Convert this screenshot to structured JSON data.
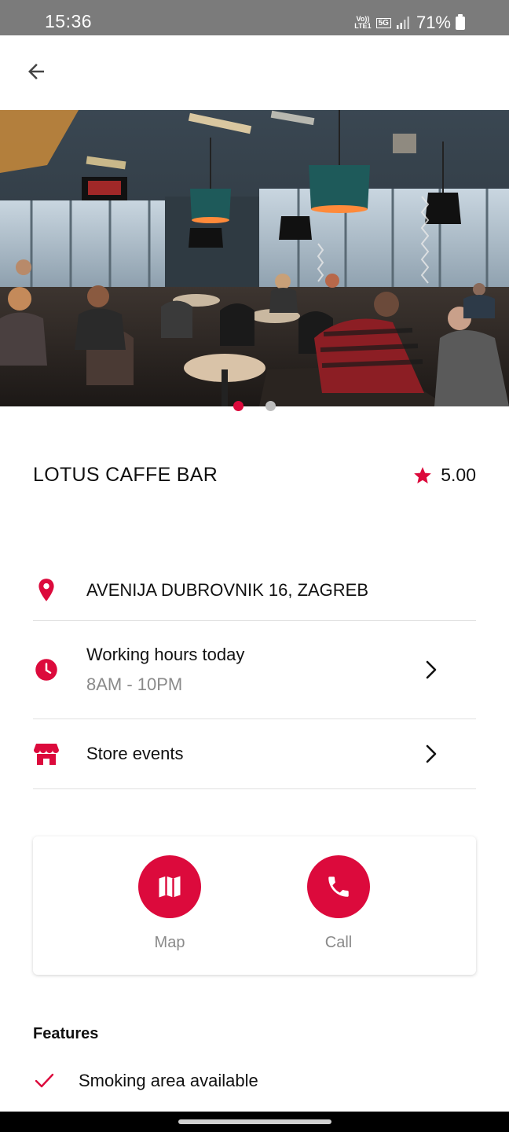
{
  "status_bar": {
    "time": "15:36",
    "volte": "Vo))\nLTE1",
    "network": "5G",
    "battery": "71%"
  },
  "app_bar": {
    "back_icon": "arrow-left-icon"
  },
  "hero": {
    "slides": 2,
    "active_slide": 1
  },
  "store": {
    "name": "LOTUS CAFFE BAR",
    "rating": "5.00",
    "address": "AVENIJA DUBROVNIK 16, ZAGREB",
    "hours_label": "Working hours today",
    "hours_value": "8AM -  10PM",
    "events_label": "Store events"
  },
  "actions": {
    "map_label": "Map",
    "call_label": "Call"
  },
  "features": {
    "title": "Features",
    "items": [
      "Smoking area available"
    ]
  },
  "colors": {
    "accent": "#dc0a3c",
    "muted": "#8a8a8a",
    "divider": "#e0e0e0"
  }
}
